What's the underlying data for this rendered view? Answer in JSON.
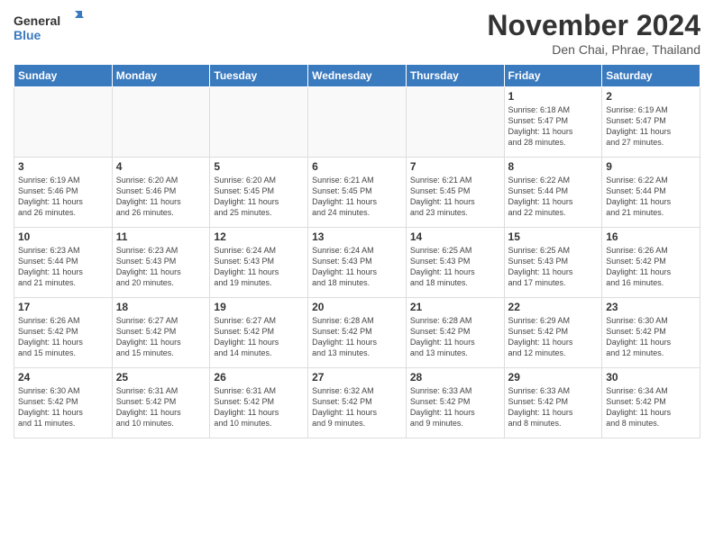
{
  "header": {
    "logo_line1": "General",
    "logo_line2": "Blue",
    "month_title": "November 2024",
    "location": "Den Chai, Phrae, Thailand"
  },
  "days_of_week": [
    "Sunday",
    "Monday",
    "Tuesday",
    "Wednesday",
    "Thursday",
    "Friday",
    "Saturday"
  ],
  "weeks": [
    [
      {
        "day": "",
        "detail": ""
      },
      {
        "day": "",
        "detail": ""
      },
      {
        "day": "",
        "detail": ""
      },
      {
        "day": "",
        "detail": ""
      },
      {
        "day": "",
        "detail": ""
      },
      {
        "day": "1",
        "detail": "Sunrise: 6:18 AM\nSunset: 5:47 PM\nDaylight: 11 hours\nand 28 minutes."
      },
      {
        "day": "2",
        "detail": "Sunrise: 6:19 AM\nSunset: 5:47 PM\nDaylight: 11 hours\nand 27 minutes."
      }
    ],
    [
      {
        "day": "3",
        "detail": "Sunrise: 6:19 AM\nSunset: 5:46 PM\nDaylight: 11 hours\nand 26 minutes."
      },
      {
        "day": "4",
        "detail": "Sunrise: 6:20 AM\nSunset: 5:46 PM\nDaylight: 11 hours\nand 26 minutes."
      },
      {
        "day": "5",
        "detail": "Sunrise: 6:20 AM\nSunset: 5:45 PM\nDaylight: 11 hours\nand 25 minutes."
      },
      {
        "day": "6",
        "detail": "Sunrise: 6:21 AM\nSunset: 5:45 PM\nDaylight: 11 hours\nand 24 minutes."
      },
      {
        "day": "7",
        "detail": "Sunrise: 6:21 AM\nSunset: 5:45 PM\nDaylight: 11 hours\nand 23 minutes."
      },
      {
        "day": "8",
        "detail": "Sunrise: 6:22 AM\nSunset: 5:44 PM\nDaylight: 11 hours\nand 22 minutes."
      },
      {
        "day": "9",
        "detail": "Sunrise: 6:22 AM\nSunset: 5:44 PM\nDaylight: 11 hours\nand 21 minutes."
      }
    ],
    [
      {
        "day": "10",
        "detail": "Sunrise: 6:23 AM\nSunset: 5:44 PM\nDaylight: 11 hours\nand 21 minutes."
      },
      {
        "day": "11",
        "detail": "Sunrise: 6:23 AM\nSunset: 5:43 PM\nDaylight: 11 hours\nand 20 minutes."
      },
      {
        "day": "12",
        "detail": "Sunrise: 6:24 AM\nSunset: 5:43 PM\nDaylight: 11 hours\nand 19 minutes."
      },
      {
        "day": "13",
        "detail": "Sunrise: 6:24 AM\nSunset: 5:43 PM\nDaylight: 11 hours\nand 18 minutes."
      },
      {
        "day": "14",
        "detail": "Sunrise: 6:25 AM\nSunset: 5:43 PM\nDaylight: 11 hours\nand 18 minutes."
      },
      {
        "day": "15",
        "detail": "Sunrise: 6:25 AM\nSunset: 5:43 PM\nDaylight: 11 hours\nand 17 minutes."
      },
      {
        "day": "16",
        "detail": "Sunrise: 6:26 AM\nSunset: 5:42 PM\nDaylight: 11 hours\nand 16 minutes."
      }
    ],
    [
      {
        "day": "17",
        "detail": "Sunrise: 6:26 AM\nSunset: 5:42 PM\nDaylight: 11 hours\nand 15 minutes."
      },
      {
        "day": "18",
        "detail": "Sunrise: 6:27 AM\nSunset: 5:42 PM\nDaylight: 11 hours\nand 15 minutes."
      },
      {
        "day": "19",
        "detail": "Sunrise: 6:27 AM\nSunset: 5:42 PM\nDaylight: 11 hours\nand 14 minutes."
      },
      {
        "day": "20",
        "detail": "Sunrise: 6:28 AM\nSunset: 5:42 PM\nDaylight: 11 hours\nand 13 minutes."
      },
      {
        "day": "21",
        "detail": "Sunrise: 6:28 AM\nSunset: 5:42 PM\nDaylight: 11 hours\nand 13 minutes."
      },
      {
        "day": "22",
        "detail": "Sunrise: 6:29 AM\nSunset: 5:42 PM\nDaylight: 11 hours\nand 12 minutes."
      },
      {
        "day": "23",
        "detail": "Sunrise: 6:30 AM\nSunset: 5:42 PM\nDaylight: 11 hours\nand 12 minutes."
      }
    ],
    [
      {
        "day": "24",
        "detail": "Sunrise: 6:30 AM\nSunset: 5:42 PM\nDaylight: 11 hours\nand 11 minutes."
      },
      {
        "day": "25",
        "detail": "Sunrise: 6:31 AM\nSunset: 5:42 PM\nDaylight: 11 hours\nand 10 minutes."
      },
      {
        "day": "26",
        "detail": "Sunrise: 6:31 AM\nSunset: 5:42 PM\nDaylight: 11 hours\nand 10 minutes."
      },
      {
        "day": "27",
        "detail": "Sunrise: 6:32 AM\nSunset: 5:42 PM\nDaylight: 11 hours\nand 9 minutes."
      },
      {
        "day": "28",
        "detail": "Sunrise: 6:33 AM\nSunset: 5:42 PM\nDaylight: 11 hours\nand 9 minutes."
      },
      {
        "day": "29",
        "detail": "Sunrise: 6:33 AM\nSunset: 5:42 PM\nDaylight: 11 hours\nand 8 minutes."
      },
      {
        "day": "30",
        "detail": "Sunrise: 6:34 AM\nSunset: 5:42 PM\nDaylight: 11 hours\nand 8 minutes."
      }
    ]
  ]
}
